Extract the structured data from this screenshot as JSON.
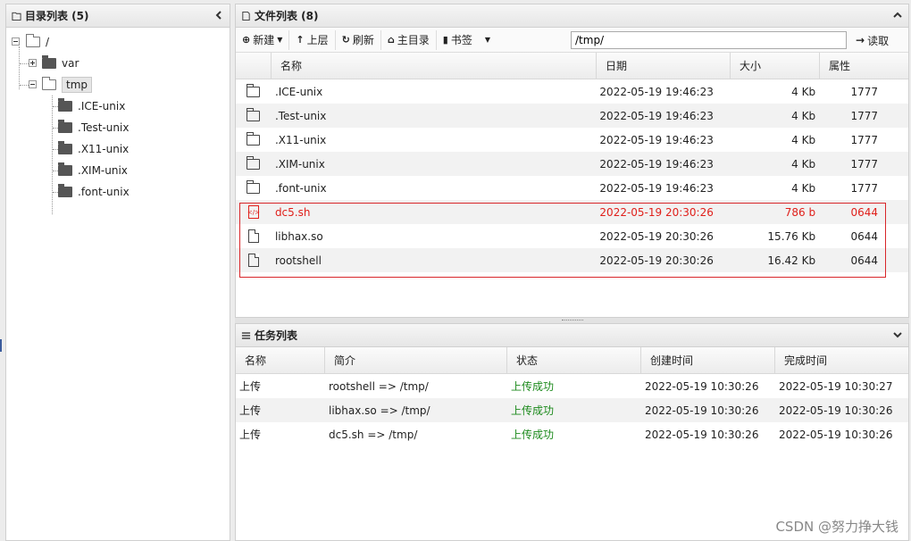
{
  "dir_panel": {
    "title": "目录列表 (5)",
    "root_label": "/",
    "items": [
      {
        "label": "var"
      },
      {
        "label": "tmp"
      }
    ],
    "tmp_children": [
      {
        "label": ".ICE-unix"
      },
      {
        "label": ".Test-unix"
      },
      {
        "label": ".X11-unix"
      },
      {
        "label": ".XIM-unix"
      },
      {
        "label": ".font-unix"
      }
    ]
  },
  "file_panel": {
    "title": "文件列表 (8)",
    "toolbar": {
      "new_label": "新建",
      "up_label": "上层",
      "refresh_label": "刷新",
      "home_label": "主目录",
      "bookmark_label": "书签",
      "path_value": "/tmp/",
      "read_label": "读取"
    },
    "columns": [
      "名称",
      "日期",
      "大小",
      "属性"
    ],
    "rows": [
      {
        "type": "folder",
        "name": ".ICE-unix",
        "date": "2022-05-19 19:46:23",
        "size": "4 Kb",
        "attr": "1777"
      },
      {
        "type": "folder",
        "name": ".Test-unix",
        "date": "2022-05-19 19:46:23",
        "size": "4 Kb",
        "attr": "1777"
      },
      {
        "type": "folder",
        "name": ".X11-unix",
        "date": "2022-05-19 19:46:23",
        "size": "4 Kb",
        "attr": "1777"
      },
      {
        "type": "folder",
        "name": ".XIM-unix",
        "date": "2022-05-19 19:46:23",
        "size": "4 Kb",
        "attr": "1777"
      },
      {
        "type": "folder",
        "name": ".font-unix",
        "date": "2022-05-19 19:46:23",
        "size": "4 Kb",
        "attr": "1777"
      },
      {
        "type": "code",
        "name": "dc5.sh",
        "date": "2022-05-19 20:30:26",
        "size": "786 b",
        "attr": "0644"
      },
      {
        "type": "file",
        "name": "libhax.so",
        "date": "2022-05-19 20:30:26",
        "size": "15.76 Kb",
        "attr": "0644"
      },
      {
        "type": "file",
        "name": "rootshell",
        "date": "2022-05-19 20:30:26",
        "size": "16.42 Kb",
        "attr": "0644"
      }
    ]
  },
  "task_panel": {
    "title": "任务列表",
    "columns": [
      "名称",
      "简介",
      "状态",
      "创建时间",
      "完成时间"
    ],
    "rows": [
      {
        "name": "上传",
        "desc": "rootshell => /tmp/",
        "status": "上传成功",
        "created": "2022-05-19 10:30:26",
        "finished": "2022-05-19 10:30:27"
      },
      {
        "name": "上传",
        "desc": "libhax.so => /tmp/",
        "status": "上传成功",
        "created": "2022-05-19 10:30:26",
        "finished": "2022-05-19 10:30:26"
      },
      {
        "name": "上传",
        "desc": "dc5.sh => /tmp/",
        "status": "上传成功",
        "created": "2022-05-19 10:30:26",
        "finished": "2022-05-19 10:30:26"
      }
    ]
  },
  "watermark": "CSDN @努力挣大钱",
  "colors": {
    "highlight": "#e0201b",
    "success": "#1c8a1c"
  }
}
